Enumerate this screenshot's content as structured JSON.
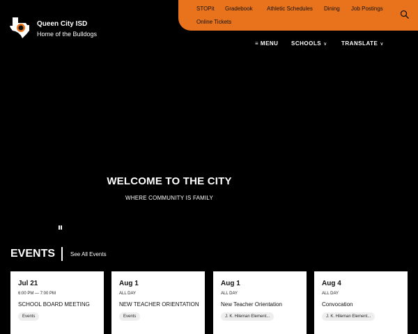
{
  "header": {
    "district_name": "Queen City ISD",
    "tagline": "Home of the Bulldogs",
    "logo_icon": "texas-bulldog-logo",
    "accent_color": "#e8731c"
  },
  "utility_links": [
    {
      "label": "STOPit"
    },
    {
      "label": "Gradebook"
    },
    {
      "label": "Athletic Schedules"
    },
    {
      "label": "Dining"
    },
    {
      "label": "Job Postings"
    },
    {
      "label": "Online Tickets"
    }
  ],
  "search": {
    "icon": "search-icon"
  },
  "nav": {
    "menu_label": "MENU",
    "schools_label": "SCHOOLS",
    "translate_label": "TRANSLATE"
  },
  "hero": {
    "title": "WELCOME TO THE CITY",
    "subtitle": "WHERE COMMUNITY IS FAMILY"
  },
  "events": {
    "heading": "EVENTS",
    "see_all": "See All Events",
    "cards": [
      {
        "date": "Jul 21",
        "time": "6:00 PM — 7:00 PM",
        "title": "SCHOOL BOARD MEETING",
        "tag": "Events"
      },
      {
        "date": "Aug 1",
        "time": "ALL DAY",
        "title": "NEW TEACHER ORIENTATION",
        "tag": "Events"
      },
      {
        "date": "Aug 1",
        "time": "ALL DAY",
        "title": "New Teacher Orientation",
        "tag": "J. K. Hileman Element..."
      },
      {
        "date": "Aug 4",
        "time": "ALL DAY",
        "title": "Convocation",
        "tag": "J. K. Hileman Element..."
      }
    ]
  }
}
